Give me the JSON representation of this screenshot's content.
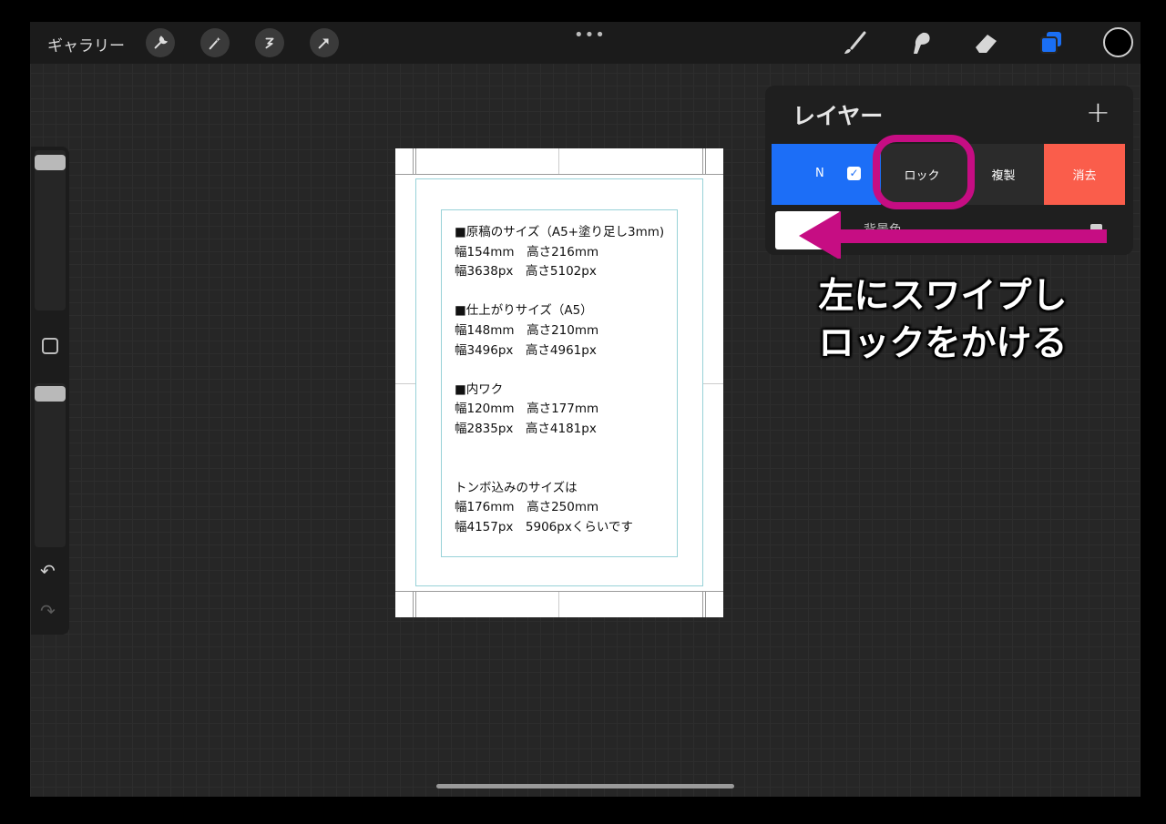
{
  "app": {
    "gallery_label": "ギャラリー"
  },
  "toolbar": {
    "left_tools": [
      "wrench-icon",
      "magic-wand-icon",
      "selection-icon",
      "transform-arrow-icon"
    ],
    "right_tools": [
      "brush-icon",
      "smudge-icon",
      "eraser-icon",
      "layers-icon"
    ],
    "color": "#000000",
    "more": "•••"
  },
  "sidebar": {
    "undo": "↶",
    "redo": "↷"
  },
  "canvas": {
    "lines": [
      "■原稿のサイズ（A5+塗り足し3mm)",
      "幅154mm　高さ216mm",
      "幅3638px　高さ5102px",
      "",
      "■仕上がりサイズ（A5）",
      "幅148mm　高さ210mm",
      "幅3496px　高さ4961px",
      "",
      "■内ワク",
      "幅120mm　高さ177mm",
      "幅2835px　高さ4181px",
      "",
      "",
      "トンボ込みのサイズは",
      "幅176mm　高さ250mm",
      "幅4157px　5906pxくらいです"
    ]
  },
  "layers_panel": {
    "title": "レイヤー",
    "add": "+",
    "layer_mode": "N",
    "check": "✓",
    "lock_label": "ロック",
    "duplicate_label": "複製",
    "delete_label": "消去",
    "background_label": "背景色"
  },
  "annotation": {
    "line1": "左にスワイプし",
    "line2": "ロックをかける",
    "color": "#c60d83"
  }
}
